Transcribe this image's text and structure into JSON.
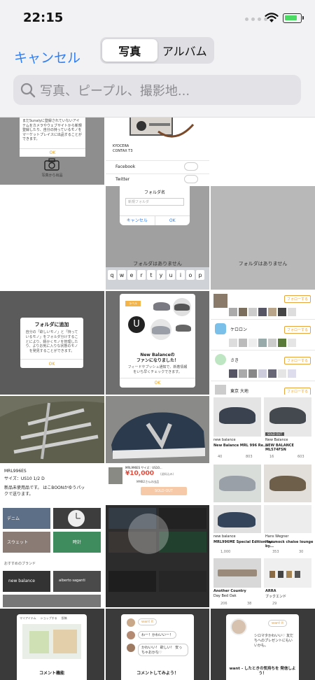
{
  "status_bar": {
    "time": "22:15"
  },
  "header": {
    "cancel_label": "キャンセル",
    "segments": [
      {
        "label": "写真",
        "active": true
      },
      {
        "label": "アルバム",
        "active": false
      }
    ],
    "search_placeholder": "写真、ピープル、撮影地..."
  },
  "grid": {
    "t00": {
      "text1": "まだSunalyに登録されていないアイテムをカメラやウェブサイトから新規登録したり、自分の持っているモノをマーケットプレイスに出品することができます。",
      "ok": "OK",
      "caption": "写真から出品"
    },
    "t01": {
      "brand1": "KYOCERA",
      "brand2": "CONTAX T3",
      "toggle1": "Facebook",
      "toggle2": "Twitter"
    },
    "t11": {
      "title": "フォルダ名",
      "placeholder": "新規フォルダ",
      "cancel": "キャンセル",
      "ok": "OK",
      "empty": "フォルダはありません",
      "keys": [
        "q",
        "w",
        "e",
        "r",
        "t",
        "y",
        "u",
        "i",
        "o",
        "p"
      ]
    },
    "t12": {
      "empty": "フォルダはありません"
    },
    "t20": {
      "title": "フォルダに追加",
      "body": "自分の「欲しいモノ」と「持っているモノ」をフォルダ分けすることにより、嬉かくモノを管理したり、よりお気に入りな状態のモノを発見することができます。",
      "ok": "OK"
    },
    "t21": {
      "brand": "New Balanceの",
      "title2": "ファンになりました！",
      "body": "フィードやプッシュ通知で、新着情報をいち早くチェックできます。",
      "ok": "OK",
      "label": "ラベル"
    },
    "t22": {
      "follow": "フォローする",
      "user2": "ケロロン",
      "user3": "さき",
      "user4": "東京 大地"
    },
    "t40": {
      "model": "MRL996ES",
      "size": "サイズ：US10 1/2 D",
      "body": "新品未使用品です。 はこBOONかゆうパックで送ります。"
    },
    "t41": {
      "title": "MRL996ES サイズ：US10...",
      "price": "¥10,000",
      "price_note": "(送料込み)",
      "seller": "MMB2さんの出品",
      "sold": "SOLD OUT"
    },
    "t42": {
      "left_brand": "new balance",
      "left_title": "New Balance MRL 996 Re...",
      "right_brand": "New Balance",
      "right_title": "NEW BALANCE ML574FSN",
      "sold": "SOLD OUT",
      "left_likes": "40",
      "left_views": "803",
      "right_likes": "16",
      "right_views": "603"
    },
    "t50": {
      "tag1": "デニム",
      "tag2": "スウェット",
      "tag3": "時計",
      "section": "おすすめのブランド",
      "brand1": "new balance",
      "brand2": "alberto saganti"
    },
    "t52": {
      "left_brand": "new balance",
      "left_title": "MRL996ME Special Edition by...",
      "left_likes": "1,000",
      "right_brand": "Hans Wegner",
      "right_title": "Hammock chaise lounge by...",
      "right_likes": "353",
      "right_views": "30"
    },
    "t53": {
      "left_brand": "Another Country",
      "left_title": "Day Bed Oak",
      "left_likes": "206",
      "left_views": "38",
      "right_brand": "ARRA",
      "right_title": "ブックエンド",
      "right_likes": "29"
    },
    "t60": {
      "title": "コメント機能",
      "tab1": "マイアイテム",
      "tab2": "ショップする",
      "tab3": "投稿"
    },
    "t61": {
      "title": "コメントしてみよう！",
      "c1": "want it",
      "c2": "わー！かわいいー！",
      "c3": "かわいい！ 欲しい！ 安っちゃおかな♡"
    },
    "t62": {
      "title": "want - したときの気持ちを 発信しよう！",
      "c1": "want it",
      "body": "シロマタかわいい♡ 友だちへのプレゼントにもいいかも。"
    }
  }
}
